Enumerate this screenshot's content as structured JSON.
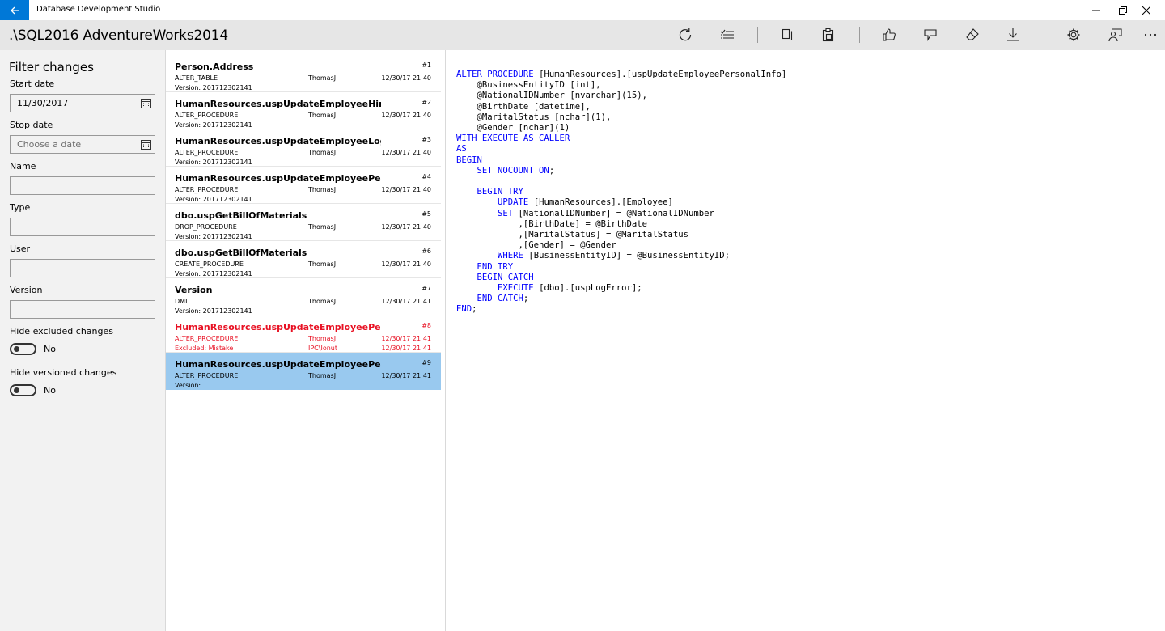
{
  "app": {
    "title": "Database Development Studio"
  },
  "header": {
    "connection": ".\\SQL2016 AdventureWorks2014"
  },
  "toolbar": {
    "icons": [
      "refresh-icon",
      "checklist-icon",
      "copy-icon",
      "paste-icon",
      "like-icon",
      "dislike-icon",
      "eraser-icon",
      "download-icon",
      "settings-icon",
      "feedback-icon",
      "more-icon"
    ]
  },
  "filter": {
    "title": "Filter changes",
    "start_date_label": "Start date",
    "start_date_value": "11/30/2017",
    "stop_date_label": "Stop date",
    "stop_date_placeholder": "Choose a date",
    "name_label": "Name",
    "type_label": "Type",
    "user_label": "User",
    "version_label": "Version",
    "hide_excluded_label": "Hide excluded changes",
    "hide_excluded_value": "No",
    "hide_versioned_label": "Hide versioned changes",
    "hide_versioned_value": "No"
  },
  "changes": [
    {
      "name": "Person.Address",
      "num": "#1",
      "type": "ALTER_TABLE",
      "user": "ThomasJ",
      "date": "12/30/17 21:40",
      "version": "Version: 201712302141"
    },
    {
      "name": "HumanResources.uspUpdateEmployeeHireInfo",
      "num": "#2",
      "type": "ALTER_PROCEDURE",
      "user": "ThomasJ",
      "date": "12/30/17 21:40",
      "version": "Version: 201712302141"
    },
    {
      "name": "HumanResources.uspUpdateEmployeeLogin",
      "num": "#3",
      "type": "ALTER_PROCEDURE",
      "user": "ThomasJ",
      "date": "12/30/17 21:40",
      "version": "Version: 201712302141"
    },
    {
      "name": "HumanResources.uspUpdateEmployeePersonalIn",
      "num": "#4",
      "type": "ALTER_PROCEDURE",
      "user": "ThomasJ",
      "date": "12/30/17 21:40",
      "version": "Version: 201712302141"
    },
    {
      "name": "dbo.uspGetBillOfMaterials",
      "num": "#5",
      "type": "DROP_PROCEDURE",
      "user": "ThomasJ",
      "date": "12/30/17 21:40",
      "version": "Version: 201712302141"
    },
    {
      "name": "dbo.uspGetBillOfMaterials",
      "num": "#6",
      "type": "CREATE_PROCEDURE",
      "user": "ThomasJ",
      "date": "12/30/17 21:40",
      "version": "Version: 201712302141"
    },
    {
      "name": "Version",
      "num": "#7",
      "type": "DML",
      "user": "ThomasJ",
      "date": "12/30/17 21:41",
      "version": "Version: 201712302141"
    },
    {
      "name": "HumanResources.uspUpdateEmployeePersonalIn",
      "num": "#8",
      "type": "ALTER_PROCEDURE",
      "user": "ThomasJ",
      "date": "12/30/17 21:41",
      "version": "Excluded: Mistake",
      "user2": "IPC\\Ionut",
      "date2": "12/30/17 21:41"
    },
    {
      "name": "HumanResources.uspUpdateEmployeePersonalIn",
      "num": "#9",
      "type": "ALTER_PROCEDURE",
      "user": "ThomasJ",
      "date": "12/30/17 21:41",
      "version": "Version:"
    }
  ],
  "code": {
    "lines": [
      [
        [
          "k",
          "ALTER PROCEDURE "
        ],
        [
          "t",
          "[HumanResources].[uspUpdateEmployeePersonalInfo]"
        ]
      ],
      [
        [
          "t",
          "    @BusinessEntityID [int],"
        ]
      ],
      [
        [
          "t",
          "    @NationalIDNumber [nvarchar](15),"
        ]
      ],
      [
        [
          "t",
          "    @BirthDate [datetime],"
        ]
      ],
      [
        [
          "t",
          "    @MaritalStatus [nchar](1),"
        ]
      ],
      [
        [
          "t",
          "    @Gender [nchar](1)"
        ]
      ],
      [
        [
          "k",
          "WITH EXECUTE AS CALLER"
        ]
      ],
      [
        [
          "k",
          "AS"
        ]
      ],
      [
        [
          "k",
          "BEGIN"
        ]
      ],
      [
        [
          "t",
          "    "
        ],
        [
          "k",
          "SET NOCOUNT ON"
        ],
        [
          "t",
          ";"
        ]
      ],
      [
        [
          "t",
          ""
        ]
      ],
      [
        [
          "t",
          "    "
        ],
        [
          "k",
          "BEGIN TRY"
        ]
      ],
      [
        [
          "t",
          "        "
        ],
        [
          "k",
          "UPDATE "
        ],
        [
          "t",
          "[HumanResources].[Employee]"
        ]
      ],
      [
        [
          "t",
          "        "
        ],
        [
          "k",
          "SET "
        ],
        [
          "t",
          "[NationalIDNumber] = @NationalIDNumber"
        ]
      ],
      [
        [
          "t",
          "            ,[BirthDate] = @BirthDate"
        ]
      ],
      [
        [
          "t",
          "            ,[MaritalStatus] = @MaritalStatus"
        ]
      ],
      [
        [
          "t",
          "            ,[Gender] = @Gender"
        ]
      ],
      [
        [
          "t",
          "        "
        ],
        [
          "k",
          "WHERE "
        ],
        [
          "t",
          "[BusinessEntityID] = @BusinessEntityID;"
        ]
      ],
      [
        [
          "t",
          "    "
        ],
        [
          "k",
          "END TRY"
        ]
      ],
      [
        [
          "t",
          "    "
        ],
        [
          "k",
          "BEGIN CATCH"
        ]
      ],
      [
        [
          "t",
          "        "
        ],
        [
          "k",
          "EXECUTE "
        ],
        [
          "t",
          "[dbo].[uspLogError];"
        ]
      ],
      [
        [
          "t",
          "    "
        ],
        [
          "k",
          "END CATCH"
        ],
        [
          "t",
          ";"
        ]
      ],
      [
        [
          "k",
          "END"
        ],
        [
          "t",
          ";"
        ]
      ]
    ]
  },
  "colors": {
    "accent": "#0078d7",
    "excluded": "#e81123",
    "selected": "#99c9ef",
    "keyword": "#0000ff"
  }
}
